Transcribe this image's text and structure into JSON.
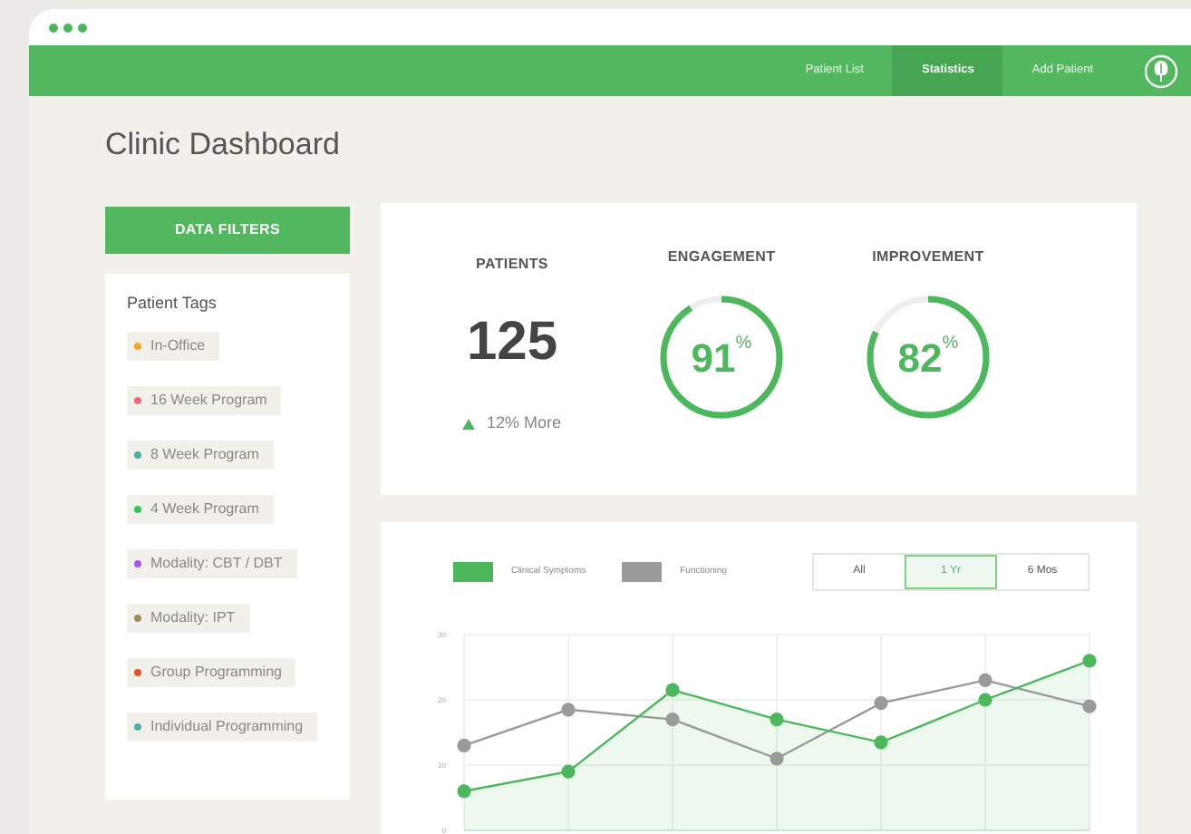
{
  "nav": {
    "items": [
      {
        "label": "Patient List",
        "selected": false
      },
      {
        "label": "Statistics",
        "selected": true
      },
      {
        "label": "Add Patient",
        "selected": false
      }
    ]
  },
  "page_title": "Clinic Dashboard",
  "filters_button": "DATA FILTERS",
  "tags": {
    "title": "Patient Tags",
    "items": [
      {
        "label": "In-Office",
        "color": "#f5a623"
      },
      {
        "label": "16 Week Program",
        "color": "#f06b7a"
      },
      {
        "label": "8 Week Program",
        "color": "#4caf9a"
      },
      {
        "label": "4 Week Program",
        "color": "#34c759"
      },
      {
        "label": "Modality: CBT / DBT",
        "color": "#a855f7"
      },
      {
        "label": "Modality: IPT",
        "color": "#a08a5a"
      },
      {
        "label": "Group Programming",
        "color": "#e5532d"
      },
      {
        "label": "Individual Programming",
        "color": "#4cb0a6"
      }
    ]
  },
  "stats": {
    "patients": {
      "label": "PATIENTS",
      "value": "125",
      "change": "12% More"
    },
    "rings": [
      {
        "label": "ENGAGEMENT",
        "value": "91",
        "unit": "%",
        "level": 0.91
      },
      {
        "label": "IMPROVEMENT",
        "value": "82",
        "unit": "%",
        "level": 0.82
      }
    ]
  },
  "chart": {
    "ranges": [
      {
        "label": "All",
        "selected": false
      },
      {
        "label": "1 Yr",
        "selected": true
      },
      {
        "label": "6 Mos",
        "selected": false
      }
    ],
    "chart_data": {
      "type": "area",
      "ylim": [
        0,
        30
      ],
      "yticks": [
        0,
        10,
        20,
        30
      ],
      "grid": true,
      "series": [
        {
          "name": "Clinical Symptoms",
          "type": "area",
          "marker": true,
          "color": "#4cb85c",
          "values": [
            6,
            9,
            21.5,
            17,
            13.5,
            20,
            26
          ]
        },
        {
          "name": "Functioning",
          "type": "line",
          "marker": true,
          "color": "#9a9a9a",
          "values": [
            13,
            18.5,
            17,
            11,
            19.5,
            23,
            19
          ]
        }
      ]
    }
  }
}
